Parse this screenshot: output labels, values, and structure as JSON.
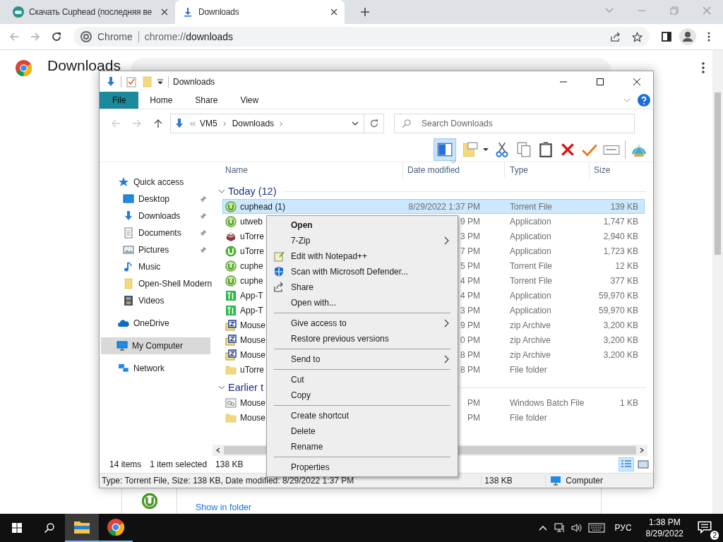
{
  "browser": {
    "tabs": [
      {
        "title": "Скачать Cuphead (последняя ве",
        "selected": false,
        "kind": "game"
      },
      {
        "title": "Downloads",
        "selected": true,
        "kind": "download"
      }
    ],
    "omnibox": {
      "chip": "Chrome",
      "url_scheme": "chrome://",
      "url_rest": "downloads"
    },
    "page_title": "Downloads",
    "download_link": "Show in folder"
  },
  "explorer": {
    "title": "Downloads",
    "ribbon_tabs": [
      {
        "label": "File",
        "selected": true
      },
      {
        "label": "Home",
        "selected": false
      },
      {
        "label": "Share",
        "selected": false
      },
      {
        "label": "View",
        "selected": false
      }
    ],
    "address": [
      "VM5",
      "Downloads"
    ],
    "search": {
      "placeholder": "Search Downloads"
    },
    "columns": [
      "Name",
      "Date modified",
      "Type",
      "Size"
    ],
    "sidebar": [
      {
        "label": "Quick access",
        "kind": "star",
        "pinned": false,
        "selected": false,
        "children": [
          {
            "label": "Desktop",
            "kind": "desktop",
            "pinned": true,
            "selected": false
          },
          {
            "label": "Downloads",
            "kind": "download",
            "pinned": true,
            "selected": false
          },
          {
            "label": "Documents",
            "kind": "document",
            "pinned": true,
            "selected": false
          },
          {
            "label": "Pictures",
            "kind": "picture",
            "pinned": true,
            "selected": false
          },
          {
            "label": "Music",
            "kind": "music",
            "pinned": false,
            "selected": false
          },
          {
            "label": "Open-Shell Modern",
            "kind": "folder",
            "pinned": false,
            "selected": false
          },
          {
            "label": "Videos",
            "kind": "video",
            "pinned": false,
            "selected": false
          }
        ]
      },
      {
        "label": "OneDrive",
        "kind": "cloud",
        "pinned": false,
        "selected": false
      },
      {
        "label": "My Computer",
        "kind": "computer",
        "pinned": false,
        "selected": true
      },
      {
        "label": "Network",
        "kind": "network",
        "pinned": false,
        "selected": false
      }
    ],
    "groups": [
      {
        "label": "Today (12)",
        "files": [
          {
            "name": "cuphead (1)",
            "date": "8/29/2022 1:37 PM",
            "type": "Torrent File",
            "size": "139 KB",
            "kind": "torrent",
            "selected": true
          },
          {
            "name": "utweb",
            "date": "9 PM",
            "type": "Application",
            "size": "1,747 KB",
            "kind": "torrent",
            "selected": false
          },
          {
            "name": "uTorre",
            "date": "3 PM",
            "type": "Application",
            "size": "2,940 KB",
            "kind": "package",
            "selected": false
          },
          {
            "name": "uTorre",
            "date": "7 PM",
            "type": "Application",
            "size": "1,723 KB",
            "kind": "utorrent",
            "selected": false
          },
          {
            "name": "cuphe",
            "date": "5 PM",
            "type": "Torrent File",
            "size": "12 KB",
            "kind": "torrent",
            "selected": false
          },
          {
            "name": "cuphe",
            "date": "4 PM",
            "type": "Torrent File",
            "size": "377 KB",
            "kind": "torrent",
            "selected": false
          },
          {
            "name": "App-T",
            "date": "4 PM",
            "type": "Application",
            "size": "59,970 KB",
            "kind": "app",
            "selected": false
          },
          {
            "name": "App-T",
            "date": "3 PM",
            "type": "Application",
            "size": "59,970 KB",
            "kind": "app",
            "selected": false
          },
          {
            "name": "Mouse",
            "date": "9 PM",
            "type": "zip Archive",
            "size": "3,200 KB",
            "kind": "zip",
            "selected": false
          },
          {
            "name": "Mouse",
            "date": "0 PM",
            "type": "zip Archive",
            "size": "3,200 KB",
            "kind": "zip",
            "selected": false
          },
          {
            "name": "Mouse",
            "date": "8 PM",
            "type": "zip Archive",
            "size": "3,200 KB",
            "kind": "zip",
            "selected": false
          },
          {
            "name": "uTorre",
            "date": "8 PM",
            "type": "File folder",
            "kind": "folder",
            "selected": false
          }
        ]
      },
      {
        "label": "Earlier t",
        "files": [
          {
            "name": "Mouse",
            "date": "PM",
            "type": "Windows Batch File",
            "size": "1 KB",
            "kind": "batch",
            "selected": false
          },
          {
            "name": "Mouse",
            "date": "PM",
            "type": "File folder",
            "kind": "folder",
            "selected": false
          }
        ]
      }
    ],
    "status": {
      "count": "14 items",
      "selection": "1 item selected",
      "size": "138 KB"
    },
    "details_bar": {
      "info": "Type: Torrent File, Size: 138 KB, Date modified: 8/29/2022 1:37 PM",
      "size": "138 KB",
      "location": "Computer"
    }
  },
  "context_menu": [
    {
      "kind": "plain",
      "label": "Open",
      "default": true,
      "submenu": false
    },
    {
      "kind": "plain",
      "label": "7-Zip",
      "default": false,
      "submenu": true
    },
    {
      "kind": "notepad",
      "label": "Edit with Notepad++",
      "default": false,
      "submenu": false
    },
    {
      "kind": "shield",
      "label": "Scan with Microsoft Defender...",
      "default": false,
      "submenu": false
    },
    {
      "kind": "share",
      "label": "Share",
      "default": false,
      "submenu": false
    },
    {
      "kind": "plain",
      "label": "Open with...",
      "default": false,
      "submenu": false
    },
    {
      "kind": "separator"
    },
    {
      "kind": "plain",
      "label": "Give access to",
      "default": false,
      "submenu": true
    },
    {
      "kind": "plain",
      "label": "Restore previous versions",
      "default": false,
      "submenu": false
    },
    {
      "kind": "separator"
    },
    {
      "kind": "plain",
      "label": "Send to",
      "default": false,
      "submenu": true
    },
    {
      "kind": "separator"
    },
    {
      "kind": "plain",
      "label": "Cut",
      "default": false,
      "submenu": false
    },
    {
      "kind": "plain",
      "label": "Copy",
      "default": false,
      "submenu": false
    },
    {
      "kind": "separator"
    },
    {
      "kind": "plain",
      "label": "Create shortcut",
      "default": false,
      "submenu": false
    },
    {
      "kind": "plain",
      "label": "Delete",
      "default": false,
      "submenu": false
    },
    {
      "kind": "plain",
      "label": "Rename",
      "default": false,
      "submenu": false
    },
    {
      "kind": "separator"
    },
    {
      "kind": "plain",
      "label": "Properties",
      "default": false,
      "submenu": false
    }
  ],
  "taskbar": {
    "apps": [
      {
        "kind": "explorer",
        "selected": true
      },
      {
        "kind": "chrome",
        "selected": false
      }
    ],
    "language": "РУС",
    "time": "1:38 PM",
    "date": "8/29/2022",
    "notifications": "2"
  }
}
